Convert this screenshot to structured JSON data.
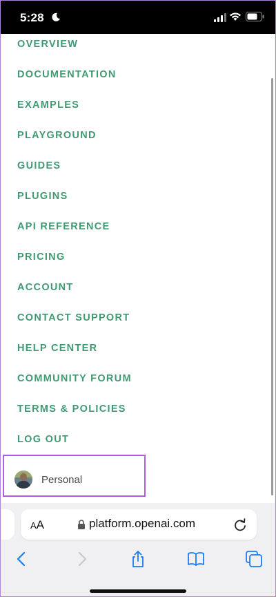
{
  "status_bar": {
    "time": "5:28",
    "icons": [
      "moon-icon",
      "cellular-signal-icon",
      "wifi-icon",
      "battery-icon"
    ]
  },
  "menu": {
    "items": [
      {
        "label": "OVERVIEW"
      },
      {
        "label": "DOCUMENTATION"
      },
      {
        "label": "EXAMPLES"
      },
      {
        "label": "PLAYGROUND"
      },
      {
        "label": "GUIDES"
      },
      {
        "label": "PLUGINS"
      },
      {
        "label": "API REFERENCE"
      },
      {
        "label": "PRICING"
      },
      {
        "label": "ACCOUNT"
      },
      {
        "label": "CONTACT SUPPORT"
      },
      {
        "label": "HELP CENTER"
      },
      {
        "label": "COMMUNITY FORUM"
      },
      {
        "label": "TERMS & POLICIES"
      },
      {
        "label": "LOG OUT"
      }
    ]
  },
  "personal": {
    "label": "Personal"
  },
  "browser": {
    "text_size_small": "A",
    "text_size_large": "A",
    "url": "platform.openai.com"
  },
  "toolbar": {
    "icons": [
      "back-icon",
      "forward-icon",
      "share-icon",
      "bookmarks-icon",
      "tabs-icon"
    ]
  },
  "colors": {
    "menu_text": "#3f9a72",
    "highlight_border": "#b05ee0",
    "safari_blue": "#1a7cf5"
  }
}
